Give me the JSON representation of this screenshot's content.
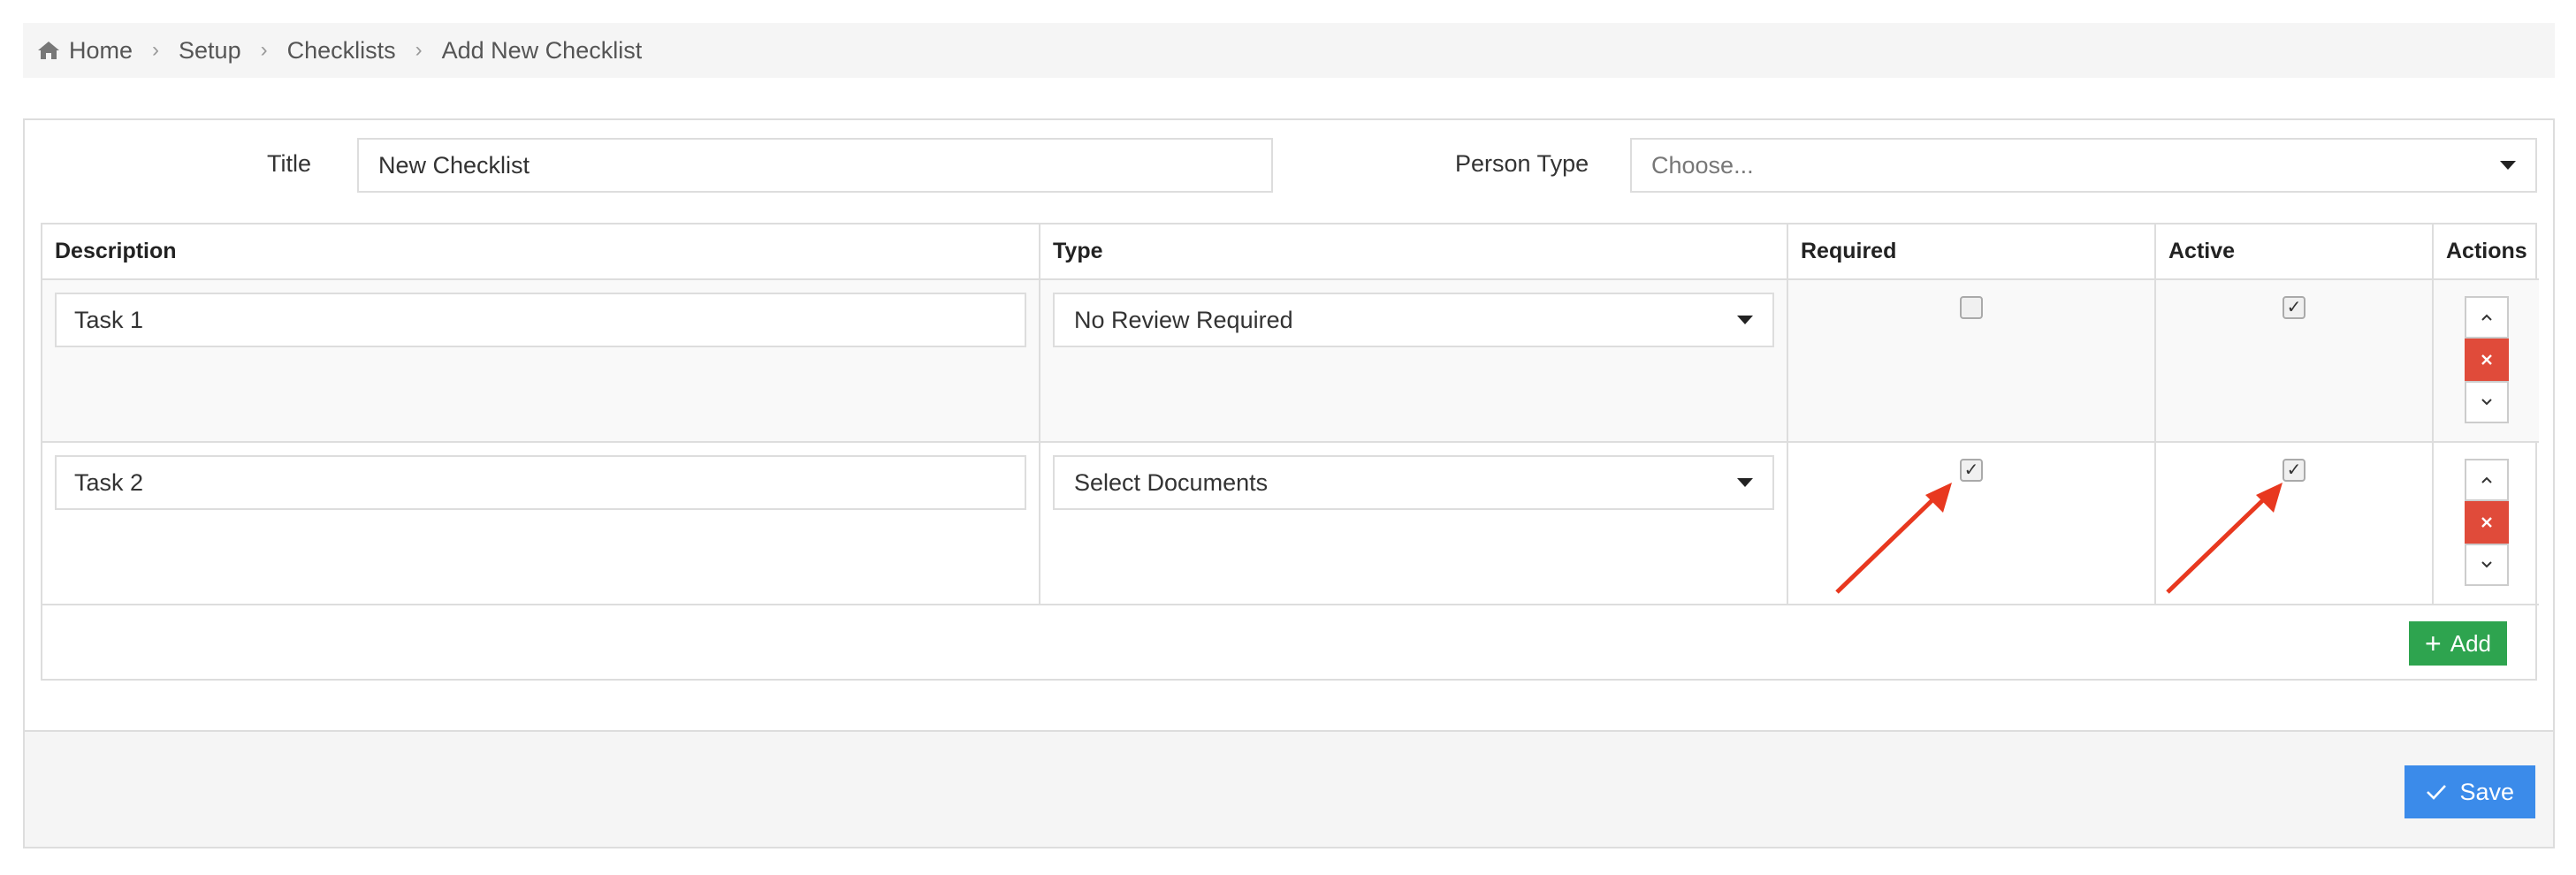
{
  "breadcrumb": {
    "items": [
      "Home",
      "Setup",
      "Checklists",
      "Add New Checklist"
    ],
    "separator": "›",
    "home_icon": "home-icon"
  },
  "form": {
    "title_label": "Title",
    "title_value": "New Checklist",
    "person_type_label": "Person Type",
    "person_type_placeholder": "Choose..."
  },
  "table": {
    "headers": [
      "Description",
      "Type",
      "Required",
      "Active",
      "Actions"
    ],
    "rows": [
      {
        "description": "Task 1",
        "type": "No Review Required",
        "required": false,
        "active": true
      },
      {
        "description": "Task 2",
        "type": "Select Documents",
        "required": true,
        "active": true
      }
    ],
    "actions": {
      "up_icon": "chevron-up-icon",
      "delete_icon": "close-icon",
      "down_icon": "chevron-down-icon"
    },
    "check_glyph": "✓"
  },
  "add_button": {
    "label": "Add",
    "icon": "plus-icon"
  },
  "save_button": {
    "label": "Save",
    "icon": "check-icon"
  },
  "colors": {
    "add": "#2ea44f",
    "save": "#3b8bea",
    "delete": "#e04b3a",
    "annotation_arrow": "#e8381f"
  }
}
